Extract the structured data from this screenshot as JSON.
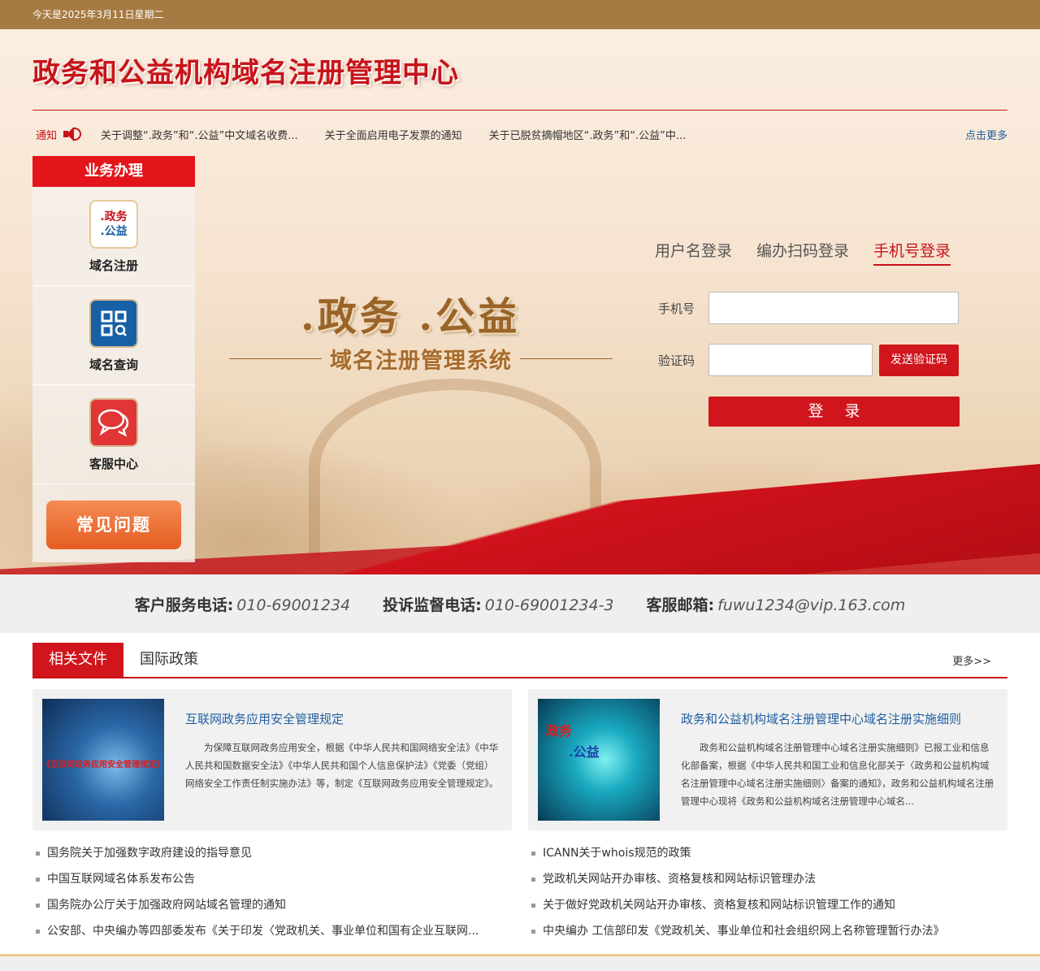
{
  "topbar": {
    "date": "今天是2025年3月11日星期二"
  },
  "header": {
    "title": "政务和公益机构域名注册管理中心"
  },
  "notice": {
    "label": "通知",
    "items": [
      "关于调整“.政务”和“.公益”中文域名收费...",
      "关于全面启用电子发票的通知",
      "关于已脱贫摘帽地区“.政务”和“.公益”中..."
    ],
    "more": "点击更多"
  },
  "sidebar": {
    "title": "业务办理",
    "items": [
      {
        "label": "域名注册",
        "icon": "domain-register-icon",
        "icon_text_a": ".政务",
        "icon_text_b": ".公益"
      },
      {
        "label": "域名查询",
        "icon": "qr-search-icon"
      },
      {
        "label": "客服中心",
        "icon": "chat-bubbles-icon"
      }
    ],
    "faq": "常见问题"
  },
  "hero": {
    "logo_line1": ".政务 .公益",
    "logo_line2": "域名注册管理系统"
  },
  "login": {
    "tabs": [
      "用户名登录",
      "编办扫码登录",
      "手机号登录"
    ],
    "active_tab": 2,
    "phone_label": "手机号",
    "code_label": "验证码",
    "send_code": "发送验证码",
    "submit": "登录",
    "phone_value": "",
    "code_value": ""
  },
  "contact": {
    "phone_label": "客户服务电话:",
    "phone": "010-69001234",
    "complaint_label": "投诉监督电话:",
    "complaint": "010-69001234-3",
    "email_label": "客服邮箱:",
    "email": "fuwu1234@vip.163.com"
  },
  "docs": {
    "tabs": [
      "相关文件",
      "国际政策"
    ],
    "active_tab": 0,
    "more": "更多>>",
    "cards": [
      {
        "title": "互联网政务应用安全管理规定",
        "text": "为保障互联网政务应用安全，根据《中华人民共和国网络安全法》《中华人民共和国数据安全法》《中华人民共和国个人信息保护法》《党委（党组）网络安全工作责任制实施办法》等，制定《互联网政务应用安全管理规定》。",
        "thumb_caption": "《互联网政务应用安全管理规定》"
      },
      {
        "title": "政务和公益机构域名注册管理中心域名注册实施细则",
        "text": "政务和公益机构域名注册管理中心域名注册实施细则》已报工业和信息化部备案，根据《中华人民共和国工业和信息化部关于〈政务和公益机构域名注册管理中心域名注册实施细则〉备案的通知》，政务和公益机构域名注册管理中心现将《政务和公益机构域名注册管理中心域名...",
        "thumb_caption_a": "政务",
        "thumb_caption_b": ".公益"
      }
    ],
    "left_list": [
      "国务院关于加强数字政府建设的指导意见",
      "中国互联网域名体系发布公告",
      "国务院办公厅关于加强政府网站域名管理的通知",
      "公安部、中央编办等四部委发布《关于印发〈党政机关、事业单位和国有企业互联网..."
    ],
    "right_list": [
      "ICANN关于whois规范的政策",
      "党政机关网站开办审核、资格复核和网站标识管理办法",
      "关于做好党政机关网站开办审核、资格复核和网站标识管理工作的通知",
      "中央编办 工信部印发《党政机关、事业单位和社会组织网上名称管理暂行办法》"
    ]
  }
}
